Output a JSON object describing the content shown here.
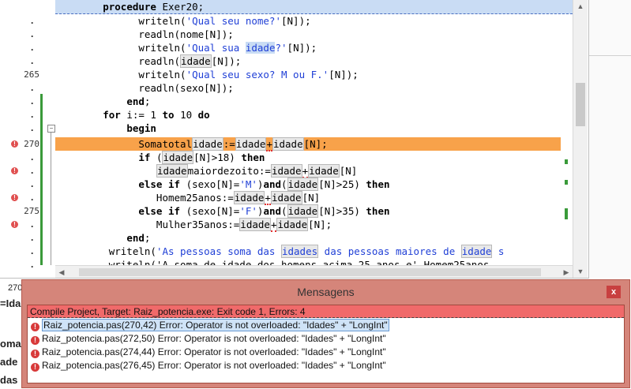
{
  "gutter": [
    {
      "num": "",
      "dot": "",
      "err": false
    },
    {
      "num": "",
      "dot": ".",
      "err": false
    },
    {
      "num": "",
      "dot": ".",
      "err": false
    },
    {
      "num": "",
      "dot": ".",
      "err": false
    },
    {
      "num": "",
      "dot": ".",
      "err": false
    },
    {
      "num": "265",
      "dot": "",
      "err": false
    },
    {
      "num": "",
      "dot": ".",
      "err": false
    },
    {
      "num": "",
      "dot": ".",
      "err": false
    },
    {
      "num": "",
      "dot": ".",
      "err": false
    },
    {
      "num": "",
      "dot": ".",
      "err": false
    },
    {
      "num": "270",
      "dot": "",
      "err": true
    },
    {
      "num": "",
      "dot": ".",
      "err": false
    },
    {
      "num": "",
      "dot": ".",
      "err": true
    },
    {
      "num": "",
      "dot": ".",
      "err": false
    },
    {
      "num": "",
      "dot": ".",
      "err": true
    },
    {
      "num": "275",
      "dot": "",
      "err": false
    },
    {
      "num": "",
      "dot": ".",
      "err": true
    },
    {
      "num": "",
      "dot": ".",
      "err": false
    },
    {
      "num": "",
      "dot": ".",
      "err": false
    },
    {
      "num": "",
      "dot": ".",
      "err": false
    }
  ],
  "code": {
    "l0": {
      "a": "        ",
      "b": "procedure",
      "c": " Exer20;"
    },
    "l1": {
      "a": "              writeln(",
      "s": "'Qual seu nome?'",
      "c": "[N]);"
    },
    "l2": {
      "a": "              readln(nome[N]);"
    },
    "l3": {
      "a": "              writeln(",
      "s1": "'Qual sua ",
      "w": "idade",
      "s2": "?'",
      "c": "[N]);"
    },
    "l4": {
      "a": "              readln(",
      "w": "idade",
      "c": "[N]);"
    },
    "l5": {
      "a": "              writeln(",
      "s": "'Qual seu sexo? M ou F.'",
      "c": "[N]);"
    },
    "l6": {
      "a": "              readln(sexo[N]);"
    },
    "l7": {
      "a": "            ",
      "k": "end",
      "c": ";"
    },
    "l8": {
      "a": "        ",
      "k1": "for",
      "b": " i:= 1 ",
      "k2": "to",
      "c": " 10 ",
      "k3": "do"
    },
    "l9": {
      "a": "            ",
      "k": "begin"
    },
    "l10": {
      "a": "              Somatotal",
      "w1": "idade",
      "o": ":=",
      "w2": "idade",
      "p": "+",
      "w3": "idade",
      "c": "[N];"
    },
    "l11": {
      "a": "              ",
      "k": "if",
      "b": " (",
      "w": "idade",
      "c": "[N]>18) ",
      "k2": "then"
    },
    "l12": {
      "a": "                 ",
      "w1": "idade",
      "b": "maiordezoito:=",
      "w2": "idade",
      "p": "+",
      "w3": "idade",
      "c": "[N]"
    },
    "l13": {
      "a": "              ",
      "k": "else",
      "b": " ",
      "k2": "if",
      "c": " (sexo[N]=",
      "s": "'M'",
      "d": ")",
      "k3": "and",
      "e": "(",
      "w": "idade",
      "f": "[N]>25) ",
      "k4": "then"
    },
    "l14": {
      "a": "                 Homem25anos:=",
      "w1": "idade",
      "p": "+",
      "w2": "idade",
      "c": "[N]"
    },
    "l15": {
      "a": "              ",
      "k": "else",
      "b": " ",
      "k2": "if",
      "c": " (sexo[N]=",
      "s": "'F'",
      "d": ")",
      "k3": "and",
      "e": "(",
      "w": "idade",
      "f": "[N]>35) ",
      "k4": "then"
    },
    "l16": {
      "a": "                 Mulher35anos:=",
      "w1": "idade",
      "p": "+",
      "w2": "idade",
      "c": "[N];"
    },
    "l17": {
      "a": "            ",
      "k": "end",
      "c": ";"
    },
    "l18": {
      "a": "         writeln(",
      "s1": "'As pessoas soma das ",
      "w1": "idades",
      "s2": " das pessoas maiores de ",
      "w2": "idade",
      "s3": " s"
    },
    "l19": {
      "a": "         writeln('A soma de idade dos homens acima 25 anos e' Homem25anos "
    }
  },
  "background": {
    "status_num": "270",
    "t1": "=Ida",
    "t2": "oma",
    "t3": "ade",
    "t4": "das"
  },
  "dialog": {
    "title": "Mensagens",
    "close": "x",
    "summary": "Compile Project, Target: Raiz_potencia.exe: Exit code 1, Errors: 4",
    "messages": [
      {
        "file": "Raiz_potencia.pas(270,42)",
        "text": " Error: Operator is not overloaded: \"Idades\" + \"LongInt\""
      },
      {
        "file": "Raiz_potencia.pas(272,50)",
        "text": " Error: Operator is not overloaded: \"Idades\" + \"LongInt\""
      },
      {
        "file": "Raiz_potencia.pas(274,44)",
        "text": " Error: Operator is not overloaded: \"Idades\" + \"LongInt\""
      },
      {
        "file": "Raiz_potencia.pas(276,45)",
        "text": " Error: Operator is not overloaded: \"Idades\" + \"LongInt\""
      }
    ]
  }
}
